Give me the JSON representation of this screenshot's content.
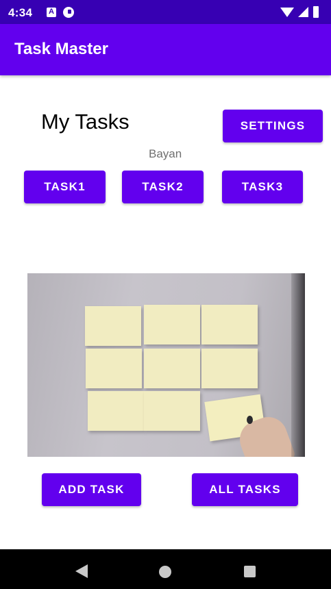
{
  "status_bar": {
    "time": "4:34",
    "icons": [
      "notification-a-icon",
      "sync-icon",
      "wifi-icon",
      "signal-icon",
      "battery-icon"
    ]
  },
  "app_bar": {
    "title": "Task Master",
    "color": "#6200EE"
  },
  "main": {
    "page_title": "My Tasks",
    "username": "Bayan",
    "settings_label": "SETTINGS",
    "task_buttons": [
      {
        "label": "TASK1"
      },
      {
        "label": "TASK2"
      },
      {
        "label": "TASK3"
      }
    ],
    "add_task_label": "ADD TASK",
    "all_tasks_label": "ALL TASKS"
  },
  "nav_bar": {
    "icons": [
      "back-icon",
      "home-icon",
      "recents-icon"
    ]
  },
  "colors": {
    "primary": "#6200EE",
    "primary_dark": "#3700B3",
    "button_text": "#FFFFFF"
  }
}
